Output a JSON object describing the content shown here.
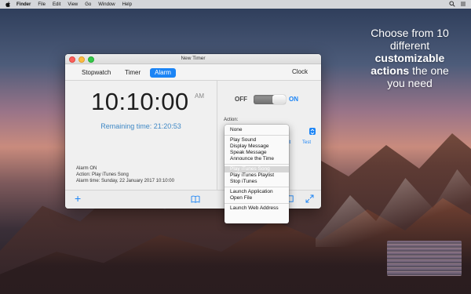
{
  "menubar": {
    "items": [
      "Finder",
      "File",
      "Edit",
      "View",
      "Go",
      "Window",
      "Help"
    ]
  },
  "promo": {
    "line1": "Choose from 10",
    "line2": "different",
    "line3_bold": "customizable",
    "line4_bold": "actions",
    "line4_rest": " the one",
    "line5": "you need"
  },
  "window": {
    "title": "New Timer",
    "tabs": [
      {
        "label": "Stopwatch"
      },
      {
        "label": "Timer"
      },
      {
        "label": "Alarm",
        "active": true
      }
    ],
    "clock_label": "Clock",
    "time": "10:10:00",
    "ampm": "AM",
    "remaining": "Remaining time: 21:20:53",
    "info": {
      "status": "Alarm ON",
      "action": "Action: Play iTunes Song",
      "alarm_time": "Alarm time: Sunday, 22 January 2017 10:10:00"
    },
    "toggle": {
      "off_label": "OFF",
      "on_label": "ON",
      "state": "on"
    },
    "action_label": "Action:",
    "edit_label": "dit",
    "test_label": "Test"
  },
  "dropdown": {
    "options": [
      "None",
      "Play Sound",
      "Display Message",
      "Speak Message",
      "Announce the Time",
      "Play iTunes Song",
      "Play iTunes Playlist",
      "Stop iTunes",
      "Launch Application",
      "Open File",
      "Launch Web Address"
    ],
    "selected": "Play iTunes Song"
  },
  "colors": {
    "accent": "#1b84f5",
    "remaining_text": "#3f88c5"
  }
}
